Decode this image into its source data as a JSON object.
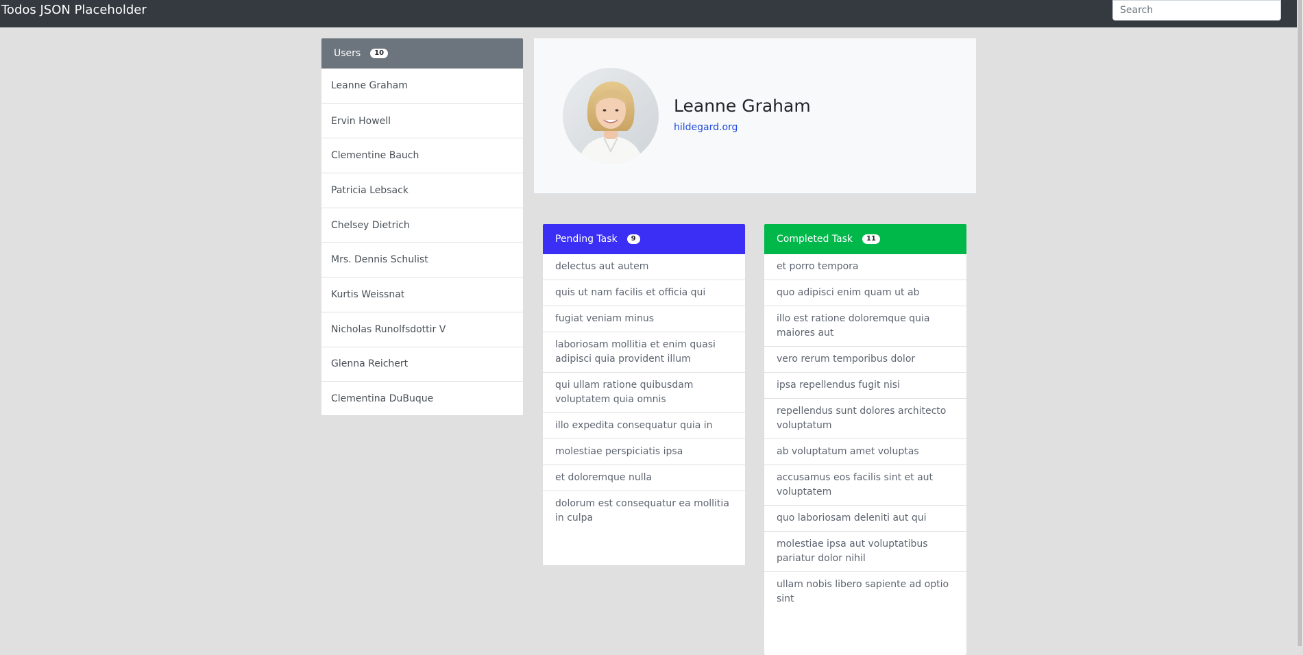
{
  "navbar": {
    "brand": "Todos JSON Placeholder",
    "search_placeholder": "Search"
  },
  "users": {
    "title": "Users",
    "count": "10",
    "items": [
      "Leanne Graham",
      "Ervin Howell",
      "Clementine Bauch",
      "Patricia Lebsack",
      "Chelsey Dietrich",
      "Mrs. Dennis Schulist",
      "Kurtis Weissnat",
      "Nicholas Runolfsdottir V",
      "Glenna Reichert",
      "Clementina DuBuque"
    ]
  },
  "profile": {
    "name": "Leanne Graham",
    "website": "hildegard.org"
  },
  "pending": {
    "title": "Pending Task",
    "count": "9",
    "items": [
      "delectus aut autem",
      "quis ut nam facilis et officia qui",
      "fugiat veniam minus",
      "laboriosam mollitia et enim quasi adipisci quia provident illum",
      "qui ullam ratione quibusdam voluptatem quia omnis",
      "illo expedita consequatur quia in",
      "molestiae perspiciatis ipsa",
      "et doloremque nulla",
      "dolorum est consequatur ea mollitia in culpa"
    ]
  },
  "completed": {
    "title": "Completed Task",
    "count": "11",
    "items": [
      "et porro tempora",
      "quo adipisci enim quam ut ab",
      "illo est ratione doloremque quia maiores aut",
      "vero rerum temporibus dolor",
      "ipsa repellendus fugit nisi",
      "repellendus sunt dolores architecto voluptatum",
      "ab voluptatum amet voluptas",
      "accusamus eos facilis sint et aut voluptatem",
      "quo laboriosam deleniti aut qui",
      "molestiae ipsa aut voluptatibus pariatur dolor nihil",
      "ullam nobis libero sapiente ad optio sint"
    ]
  },
  "colors": {
    "navbar": "#343a40",
    "users_header": "#6c757d",
    "pending_header": "#3b2ff5",
    "completed_header": "#00b74a",
    "link": "#1e4bdb"
  }
}
